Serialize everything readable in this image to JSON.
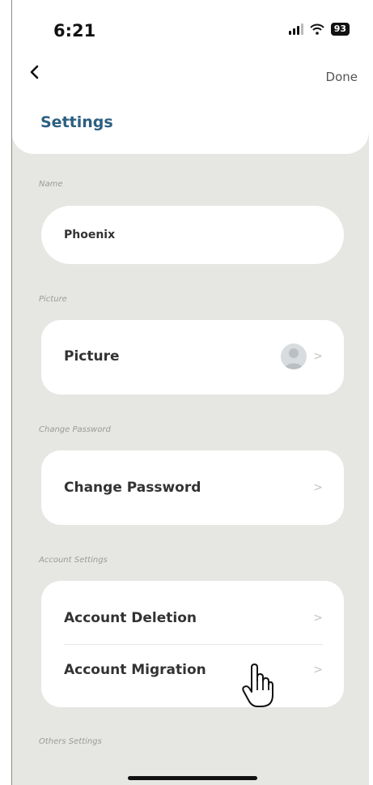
{
  "status_bar": {
    "time": "6:21",
    "battery": "93"
  },
  "nav": {
    "back_icon": "chevron-left-icon",
    "done_label": "Done"
  },
  "page": {
    "title": "Settings"
  },
  "sections": {
    "name": {
      "label": "Name",
      "value": "Phoenix"
    },
    "picture": {
      "label": "Picture",
      "row_label": "Picture"
    },
    "password": {
      "label": "Change Password",
      "row_label": "Change Password"
    },
    "account": {
      "label": "Account Settings",
      "items": [
        {
          "label": "Account Deletion"
        },
        {
          "label": "Account Migration"
        }
      ]
    },
    "others": {
      "label": "Others Settings"
    }
  },
  "colors": {
    "background": "#e6e6e3",
    "card": "#ffffff",
    "title_accent": "#2c5f80"
  }
}
